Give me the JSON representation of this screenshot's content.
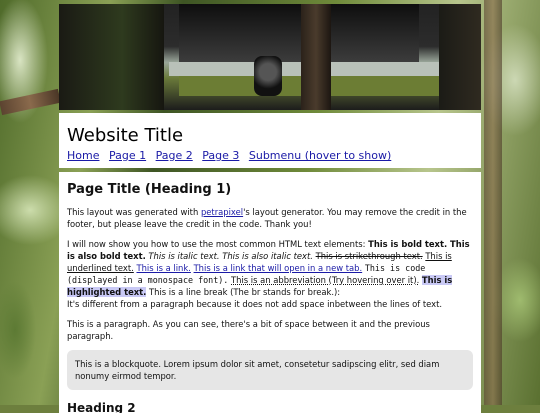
{
  "header": {
    "title": "Website Title",
    "nav": [
      "Home",
      "Page 1",
      "Page 2",
      "Page 3",
      "Submenu (hover to show)"
    ]
  },
  "page": {
    "heading1": "Page Title (Heading 1)",
    "intro_before": "This layout was generated with ",
    "intro_link": "petrapixel",
    "intro_after": "'s layout generator. You may remove the credit in the footer, but please leave the credit in the code. Thank you!",
    "p2_lead": "I will now show you how to use the most common HTML text elements: ",
    "bold": "This is bold text. This is also bold text.",
    "italic": "This is italic text. This is also italic text.",
    "strike": "This is strikethrough text.",
    "underline": "This is underlined text.",
    "link1": "This is a link.",
    "link2": "This is a link that will open in a new tab.",
    "code": "This is code (displayed in a monospace font).",
    "abbr": "This is an abbreviation (Try hovering over it).",
    "highlight": "This is highlighted text.",
    "linebreak_line1": "This is a line break (The br stands for break.):",
    "linebreak_line2": "It's different from a paragraph because it does not add space inbetween the lines of text.",
    "paragraph": "This is a paragraph. As you can see, there's a bit of space between it and the previous paragraph.",
    "blockquote": "This is a blockquote. Lorem ipsum dolor sit amet, consetetur sadipscing elitr, sed diam nonumy eirmod tempor.",
    "heading2": "Heading 2"
  },
  "colors": {
    "link": "#1a1aa6",
    "highlight": "#c9c9f5",
    "quote_bg": "#e6e6e6"
  }
}
